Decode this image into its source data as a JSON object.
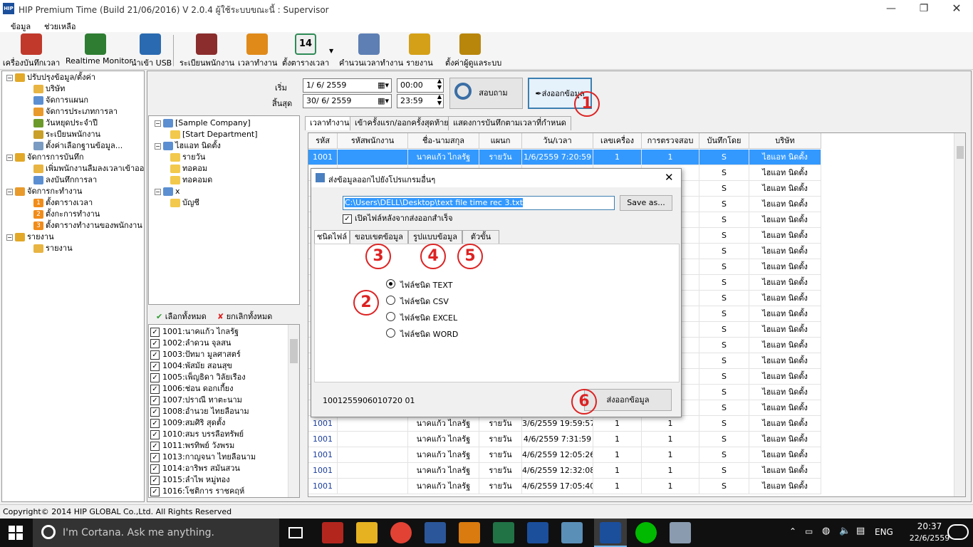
{
  "window": {
    "title": "HIP Premium Time (Build 21/06/2016) V 2.0.4   ผู้ใช้ระบบขณะนี้ : Supervisor",
    "app_icon": "HIP"
  },
  "menu": [
    "ข้อมูล",
    "ช่วยเหลือ"
  ],
  "toolbar": [
    {
      "label": "เครื่องบันทึกเวลา",
      "icon": "time-clock-icon",
      "color": "#c0392b"
    },
    {
      "label": "Realtime Monitor",
      "icon": "monitor-icon",
      "color": "#2e7d32"
    },
    {
      "label": "นำเข้า USB",
      "icon": "usb-icon",
      "color": "#2a6ab0"
    },
    {
      "label": "ระเบียนพนักงาน",
      "icon": "employees-icon",
      "color": "#8b2d2d"
    },
    {
      "label": "เวลาทำงาน",
      "icon": "stopwatch-icon",
      "color": "#e08a1a"
    },
    {
      "label": "ตั้งตารางเวลา",
      "icon": "calendar-icon",
      "color": "#2e8b57",
      "badge": "14"
    },
    {
      "label": "คำนวนเวลาทำงาน",
      "icon": "calculate-icon",
      "color": "#5d7fb3"
    },
    {
      "label": "รายงาน",
      "icon": "report-icon",
      "color": "#d4a017"
    },
    {
      "label": "ตั้งค่าผู้ดูแลระบบ",
      "icon": "admin-settings-icon",
      "color": "#b8860b"
    }
  ],
  "tree": [
    {
      "label": "ปรับปรุงข้อมูล/ตั้งค่า",
      "level": 0
    },
    {
      "label": "บริษัท",
      "level": 1
    },
    {
      "label": "จัดการแผนก",
      "level": 1
    },
    {
      "label": "จัดการประเภทการลา",
      "level": 1
    },
    {
      "label": "วันหยุดประจำปี",
      "level": 1
    },
    {
      "label": "ระเบียนพนักงาน",
      "level": 1
    },
    {
      "label": "ตั้งค่าเลือกฐานข้อมูล...",
      "level": 1
    },
    {
      "label": "จัดการการบันทึก",
      "level": 0
    },
    {
      "label": "เพิ่มพนักงานลืมลงเวลาเข้าออก",
      "level": 1
    },
    {
      "label": "ลงบันทึกการลา",
      "level": 1
    },
    {
      "label": "จัดการกะทำงาน",
      "level": 0
    },
    {
      "label": "ตั้งตารางเวลา",
      "level": 1,
      "num": "1"
    },
    {
      "label": "ตั้งกะการทำงาน",
      "level": 1,
      "num": "2"
    },
    {
      "label": "ตั้งตารางทำงานของพนักงาน",
      "level": 1,
      "num": "3"
    },
    {
      "label": "รายงาน",
      "level": 0
    },
    {
      "label": "รายงาน",
      "level": 1
    }
  ],
  "filter": {
    "start_label": "เริ่ม",
    "end_label": "สิ้นสุด",
    "start_date": "1/ 6/ 2559",
    "end_date": "30/ 6/ 2559",
    "start_time": "00:00",
    "end_time": "23:59",
    "search_button": "สอบถาม",
    "export_button": "ส่งออกข้อมูล"
  },
  "company_tree": [
    {
      "label": "[Sample Company]",
      "level": 0
    },
    {
      "label": "[Start Department]",
      "level": 1
    },
    {
      "label": "ไฮแอท นิดตั้ง",
      "level": 0
    },
    {
      "label": "รายวัน",
      "level": 1
    },
    {
      "label": "ทอคอม",
      "level": 1
    },
    {
      "label": "ทอคอมด",
      "level": 1
    },
    {
      "label": "x",
      "level": 0
    },
    {
      "label": "บัญชี",
      "level": 1
    }
  ],
  "select_all": "เลือกทั้งหมด",
  "deselect_all": "ยกเลิกทั้งหมด",
  "employees": [
    "1001:นาคแก้ว ไกลรัฐ",
    "1002:ลำดวน จุลสน",
    "1003:ปัทมา มูลศาสตร์",
    "1004:พัสมัย สอนสุข",
    "1005:เพ็ญธิดา วิลัยเรือง",
    "1006:ช่อน ดอกเกี้ยง",
    "1007:ปราณี ทาตะนาม",
    "1008:อำนวย ไทยลือนาม",
    "1009:สมศิริ สุดตั้ง",
    "1010:สมร บรรลือทรัพย์",
    "1011:พรทิพย์ วังพรม",
    "1013:กาญจนา ไทยลือนาม",
    "1014:อาริพร สมันสวน",
    "1015:ลำไพ หมู่ทอง",
    "1016:โชติการ ราชคฤห์"
  ],
  "tabs": [
    "เวลาทำงาน",
    "เข้าครั้งแรก/ออกครั้งสุดท้าย",
    "แสดงการบันทึกตามเวลาที่กำหนด"
  ],
  "grid": {
    "columns": [
      "รหัส",
      "รหัสพนักงาน",
      "ชื่อ-นามสกุล",
      "แผนก",
      "วัน/เวลา",
      "เลขเครื่อง",
      "การตรวจสอบ",
      "บันทึกโดย",
      "บริษัท"
    ],
    "rows": [
      [
        "1001",
        "",
        "นาคแก้ว ไกลรัฐ",
        "รายวัน",
        "1/6/2559 7:20:59",
        "1",
        "1",
        "S",
        "ไฮแอท นิดตั้ง"
      ],
      [
        "",
        "",
        "",
        "",
        "",
        "",
        "",
        "S",
        "ไฮแอท นิดตั้ง"
      ],
      [
        "",
        "",
        "",
        "",
        "",
        "",
        "",
        "S",
        "ไฮแอท นิดตั้ง"
      ],
      [
        "",
        "",
        "",
        "",
        "",
        "",
        "",
        "S",
        "ไฮแอท นิดตั้ง"
      ],
      [
        "",
        "",
        "",
        "",
        "",
        "",
        "",
        "S",
        "ไฮแอท นิดตั้ง"
      ],
      [
        "",
        "",
        "",
        "",
        "",
        "",
        "",
        "S",
        "ไฮแอท นิดตั้ง"
      ],
      [
        "",
        "",
        "",
        "",
        "",
        "",
        "",
        "S",
        "ไฮแอท นิดตั้ง"
      ],
      [
        "",
        "",
        "",
        "",
        "",
        "",
        "",
        "S",
        "ไฮแอท นิดตั้ง"
      ],
      [
        "",
        "",
        "",
        "",
        "",
        "",
        "",
        "S",
        "ไฮแอท นิดตั้ง"
      ],
      [
        "",
        "",
        "",
        "",
        "",
        "",
        "",
        "S",
        "ไฮแอท นิดตั้ง"
      ],
      [
        "",
        "",
        "",
        "",
        "",
        "",
        "",
        "S",
        "ไฮแอท นิดตั้ง"
      ],
      [
        "",
        "",
        "",
        "",
        "",
        "",
        "",
        "S",
        "ไฮแอท นิดตั้ง"
      ],
      [
        "",
        "",
        "",
        "",
        "",
        "",
        "",
        "S",
        "ไฮแอท นิดตั้ง"
      ],
      [
        "",
        "",
        "",
        "",
        "",
        "",
        "",
        "S",
        "ไฮแอท นิดตั้ง"
      ],
      [
        "",
        "",
        "",
        "",
        "",
        "",
        "",
        "S",
        "ไฮแอท นิดตั้ง"
      ],
      [
        "",
        "",
        "",
        "",
        "",
        "",
        "",
        "S",
        "ไฮแอท นิดตั้ง"
      ],
      [
        "",
        "",
        "",
        "",
        "",
        "",
        "",
        "S",
        "ไฮแอท นิดตั้ง"
      ],
      [
        "1001",
        "",
        "นาคแก้ว ไกลรัฐ",
        "รายวัน",
        "3/6/2559 19:59:57",
        "1",
        "1",
        "S",
        "ไฮแอท นิดตั้ง"
      ],
      [
        "1001",
        "",
        "นาคแก้ว ไกลรัฐ",
        "รายวัน",
        "4/6/2559 7:31:59",
        "1",
        "1",
        "S",
        "ไฮแอท นิดตั้ง"
      ],
      [
        "1001",
        "",
        "นาคแก้ว ไกลรัฐ",
        "รายวัน",
        "4/6/2559 12:05:26",
        "1",
        "1",
        "S",
        "ไฮแอท นิดตั้ง"
      ],
      [
        "1001",
        "",
        "นาคแก้ว ไกลรัฐ",
        "รายวัน",
        "4/6/2559 12:32:08",
        "1",
        "1",
        "S",
        "ไฮแอท นิดตั้ง"
      ],
      [
        "1001",
        "",
        "นาคแก้ว ไกลรัฐ",
        "รายวัน",
        "4/6/2559 17:05:40",
        "1",
        "1",
        "S",
        "ไฮแอท นิดตั้ง"
      ]
    ]
  },
  "dialog": {
    "title": "ส่งข้อมูลออกไปยังโปรแกรมอื่นๆ",
    "path": "C:\\Users\\DELL\\Desktop\\text file time rec 3.txt",
    "save_as": "Save as...",
    "open_after": "เปิดไฟล์หลังจากส่งออกสำเร็จ",
    "tabs": [
      "ชนิดไฟล์",
      "ขอบเขตข้อมูล",
      "รูปแบบข้อมูล",
      "ตัวขั้น"
    ],
    "options": [
      "ไฟล์ชนิด TEXT",
      "ไฟล์ชนิด CSV",
      "ไฟล์ชนิด EXCEL",
      "ไฟล์ชนิด WORD"
    ],
    "selected_option": 0,
    "code": "1001255906010720 01",
    "export_button": "ส่งออกข้อมูล"
  },
  "annotations": [
    "1",
    "2",
    "3",
    "4",
    "5",
    "6"
  ],
  "status": "Copyright© 2014 HIP GLOBAL Co.,Ltd. All Rights Reserved",
  "taskbar": {
    "search": "I'm Cortana. Ask me anything.",
    "lang": "ENG",
    "time": "20:37",
    "date": "22/6/2559"
  },
  "colors": {
    "accent": "#0078d7",
    "selection": "#3399ff",
    "annotation": "#d22222",
    "id_blue": "#1a3d9c"
  }
}
